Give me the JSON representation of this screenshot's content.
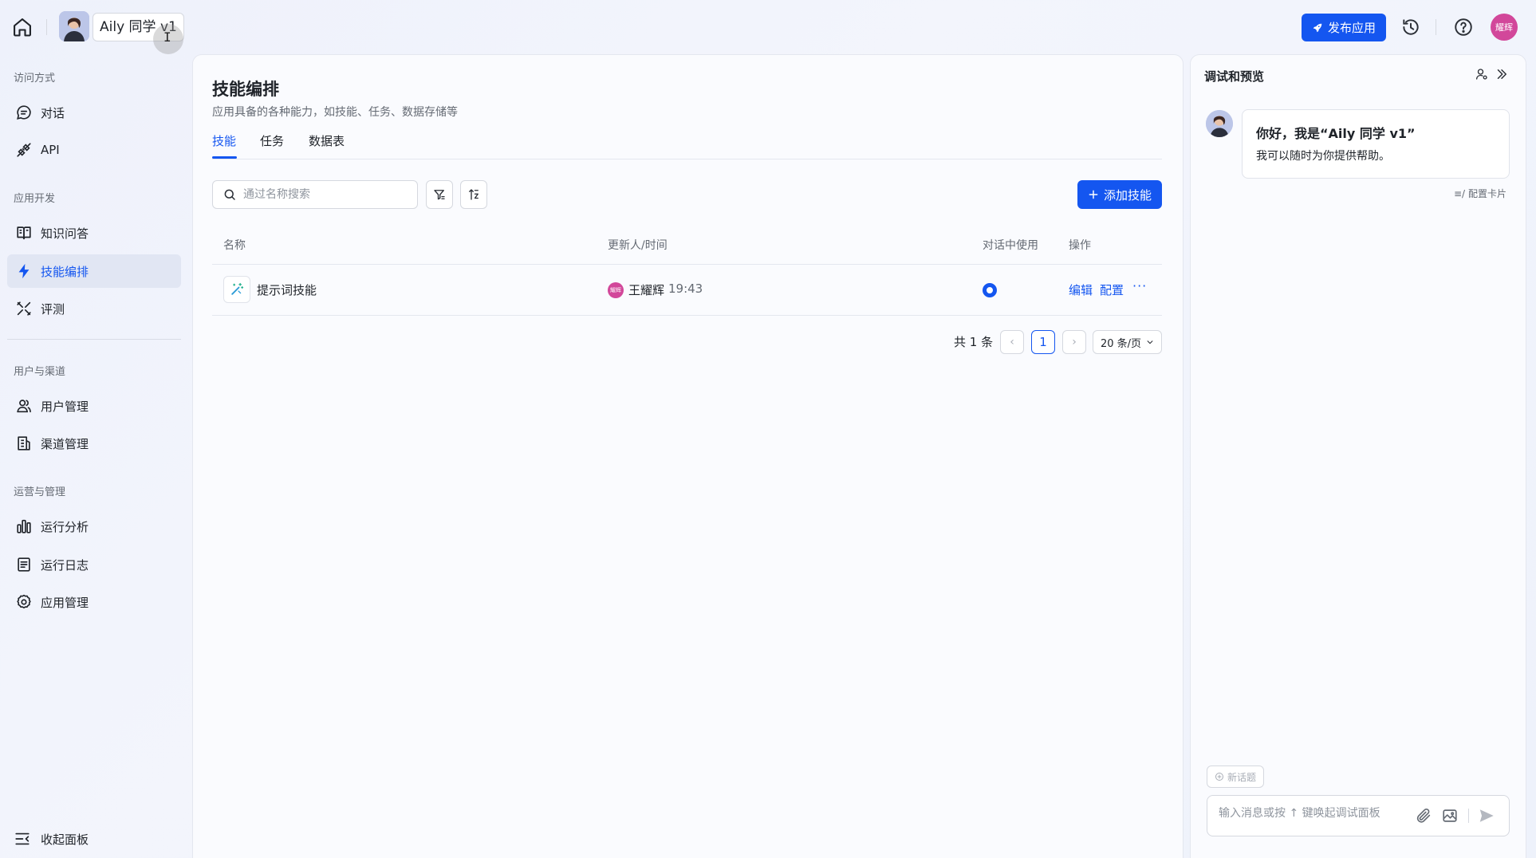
{
  "header": {
    "app_name": "Aily 同学 v1",
    "publish_label": "发布应用",
    "user_avatar_text": "耀辉",
    "cursor_glyph": "I"
  },
  "sidebar": {
    "sections": [
      {
        "title": "访问方式",
        "items": [
          {
            "label": "对话",
            "icon": "chat-icon"
          },
          {
            "label": "API",
            "icon": "api-plug-icon"
          }
        ]
      },
      {
        "title": "应用开发",
        "items": [
          {
            "label": "知识问答",
            "icon": "book-icon"
          },
          {
            "label": "技能编排",
            "icon": "lightning-icon",
            "active": true
          },
          {
            "label": "评测",
            "icon": "tools-icon"
          }
        ]
      },
      {
        "title": "用户与渠道",
        "items": [
          {
            "label": "用户管理",
            "icon": "users-icon"
          },
          {
            "label": "渠道管理",
            "icon": "channel-icon"
          }
        ]
      },
      {
        "title": "运营与管理",
        "items": [
          {
            "label": "运行分析",
            "icon": "bar-chart-icon"
          },
          {
            "label": "运行日志",
            "icon": "log-icon"
          },
          {
            "label": "应用管理",
            "icon": "gear-icon"
          }
        ]
      }
    ],
    "collapse_label": "收起面板"
  },
  "main": {
    "title": "技能编排",
    "subtitle": "应用具备的各种能力，如技能、任务、数据存储等",
    "tabs": [
      {
        "label": "技能",
        "active": true
      },
      {
        "label": "任务"
      },
      {
        "label": "数据表"
      }
    ],
    "search_placeholder": "通过名称搜索",
    "add_label": "添加技能",
    "columns": [
      "名称",
      "更新人/时间",
      "对话中使用",
      "操作"
    ],
    "rows": [
      {
        "name": "提示词技能",
        "updater_avatar": "耀辉",
        "updater": "王耀辉",
        "time": "19:43",
        "in_chat": true,
        "actions": [
          "编辑",
          "配置"
        ],
        "more": "···"
      }
    ],
    "pagination": {
      "total": "共 1 条",
      "current": "1",
      "prev": "‹",
      "next": "›",
      "page_size": "20 条/页"
    }
  },
  "preview": {
    "title": "调试和预览",
    "greeting_title": "你好，我是“Aily 同学 v1”",
    "greeting_body": "我可以随时为你提供帮助。",
    "config_card": "配置卡片",
    "new_topic": "新话题",
    "input_placeholder": "输入消息或按 ↑ 键唤起调试面板"
  },
  "colors": {
    "accent": "#1456f0",
    "avatar_pink": "#d2479a"
  }
}
